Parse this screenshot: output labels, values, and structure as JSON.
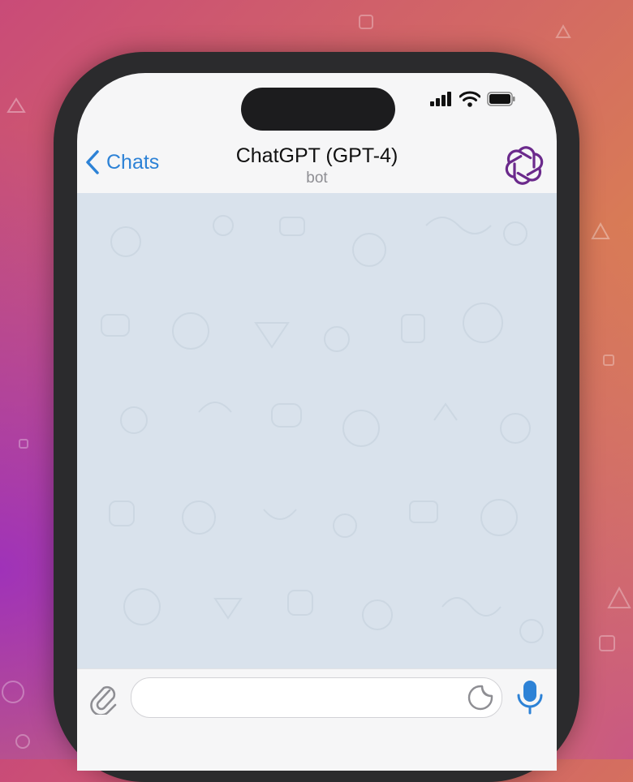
{
  "colors": {
    "accent": "#2d82d6",
    "logo": "#6b2a8c",
    "chat_background": "#d9e2ec"
  },
  "status_bar": {
    "icons": [
      "signal-icon",
      "wifi-icon",
      "battery-icon"
    ]
  },
  "header": {
    "back_label": "Chats",
    "title": "ChatGPT (GPT-4)",
    "subtitle": "bot",
    "avatar_icon": "openai-logo-icon"
  },
  "composer": {
    "message_value": "",
    "placeholder": "",
    "icons": [
      "paperclip-icon",
      "sticker-icon",
      "microphone-icon"
    ]
  }
}
